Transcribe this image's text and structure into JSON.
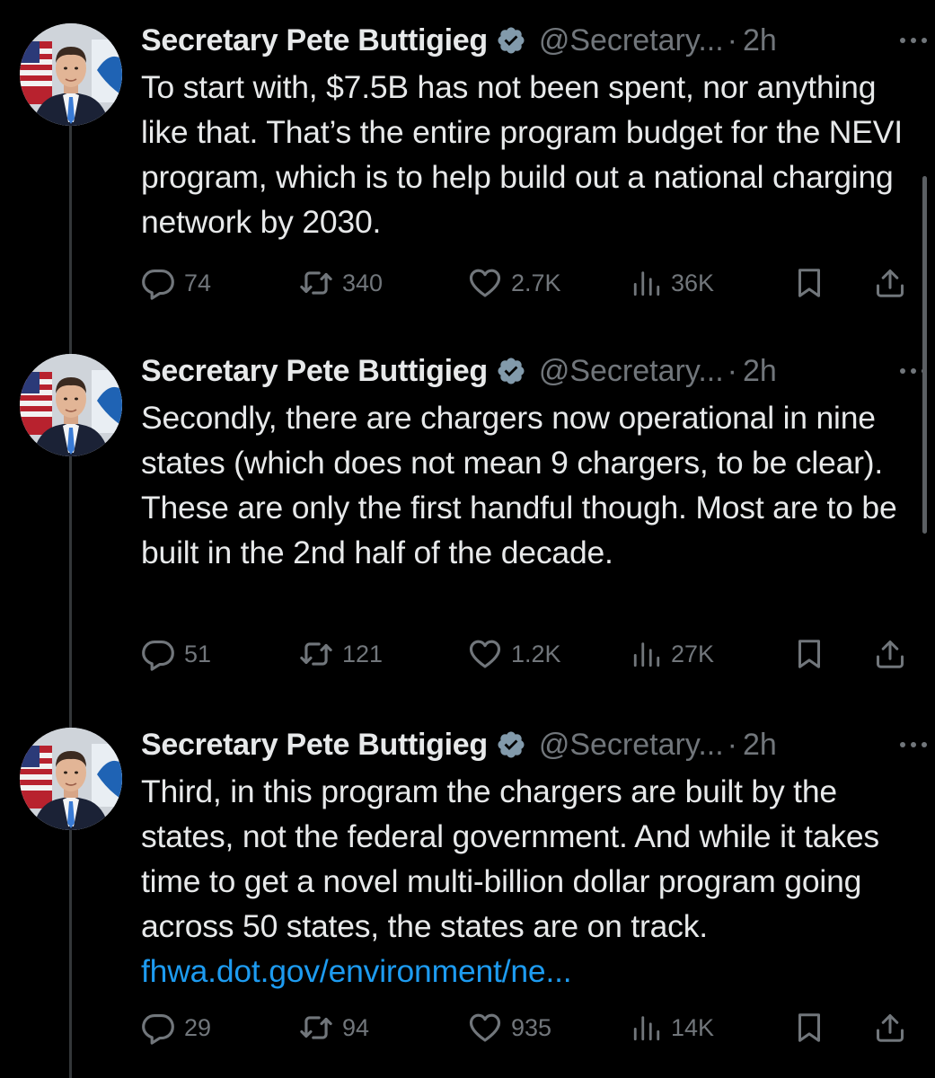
{
  "thread": {
    "tweets": [
      {
        "author_name": "Secretary Pete Buttigieg",
        "handle": "@Secretary...",
        "separator": "·",
        "time": "2h",
        "text": "To start with, $7.5B has not been spent, nor anything like that. That’s the entire program budget for the NEVI program, which is to help build out a national charging network by 2030.",
        "link_text": "",
        "replies": "74",
        "retweets": "340",
        "likes": "2.7K",
        "views": "36K"
      },
      {
        "author_name": "Secretary Pete Buttigieg",
        "handle": "@Secretary...",
        "separator": "·",
        "time": "2h",
        "text": "Secondly, there are chargers now operational in nine states (which does not mean 9 chargers, to be clear). These are only the first handful though. Most are to be built in the 2nd half of the decade.",
        "link_text": "",
        "replies": "51",
        "retweets": "121",
        "likes": "1.2K",
        "views": "27K"
      },
      {
        "author_name": "Secretary Pete Buttigieg",
        "handle": "@Secretary...",
        "separator": "·",
        "time": "2h",
        "text": "Third, in this program the chargers are built by the states, not the federal government. And while it takes time to get a novel multi-billion dollar program going across 50 states, the states are on track. ",
        "link_text": "fhwa.dot.gov/environment/ne...",
        "replies": "29",
        "retweets": "94",
        "likes": "935",
        "views": "14K"
      }
    ]
  },
  "icons": {
    "verified": "verified-badge-icon",
    "more": "more-options-icon",
    "reply": "reply-icon",
    "retweet": "retweet-icon",
    "like": "heart-icon",
    "views": "views-icon",
    "bookmark": "bookmark-icon",
    "share": "share-icon"
  },
  "colors": {
    "background": "#000000",
    "text": "#e7e9ea",
    "secondary": "#71767b",
    "link": "#1d9bf0",
    "verified_badge": "#829aab",
    "thread_line": "#333639"
  }
}
